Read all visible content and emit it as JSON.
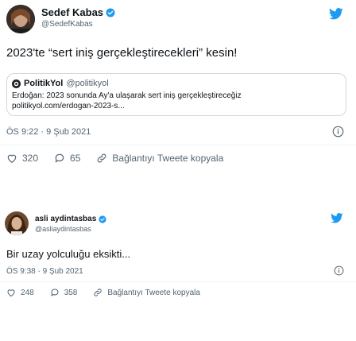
{
  "tweet1": {
    "name": "Sedef Kabas",
    "handle": "@SedefKabas",
    "text": "2023'te “sert iniş gerçekleştirecekleri” kesin!",
    "quote": {
      "name": "PolitikYol",
      "handle": "@politikyol",
      "line1": "Erdoğan: 2023 sonunda Ay'a ulaşarak sert iniş gerçekleştireceğiz",
      "line2": "politikyol.com/erdogan-2023-s..."
    },
    "timestamp": "ÖS 9:22 · 9 Şub 2021",
    "likes": "320",
    "replies": "65",
    "copy_link_label": "Bağlantıyı Tweete kopyala"
  },
  "tweet2": {
    "name": "asli aydintasbas",
    "handle": "@asliaydintasbas",
    "text": "Bir uzay yolculuğu eksikti...",
    "timestamp": "ÖS 9:38 · 9 Şub 2021",
    "likes": "248",
    "replies": "358",
    "copy_link_label": "Bağlantıyı Tweete kopyala"
  },
  "colors": {
    "twitter_blue": "#1d9bf0",
    "muted": "#536471",
    "border": "#cfd9de"
  },
  "icons": [
    "twitter-bird-icon",
    "verified-badge-icon",
    "info-icon",
    "heart-icon",
    "reply-icon",
    "link-icon"
  ]
}
